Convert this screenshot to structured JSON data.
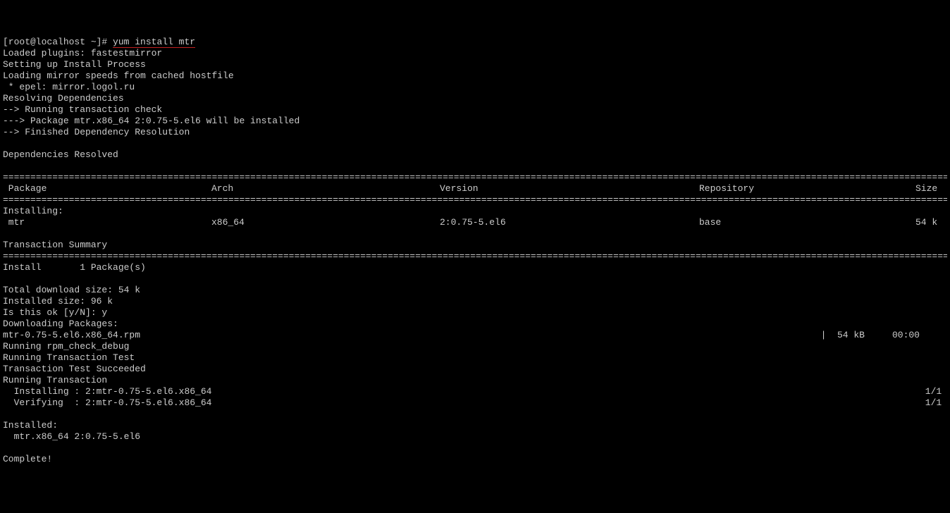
{
  "prompt_prefix": "[root@localhost ~]# ",
  "command": "yum install mtr",
  "lines_pre": [
    "Loaded plugins: fastestmirror",
    "Setting up Install Process",
    "Loading mirror speeds from cached hostfile",
    " * epel: mirror.logol.ru",
    "Resolving Dependencies",
    "--> Running transaction check",
    "---> Package mtr.x86_64 2:0.75-5.el6 will be installed",
    "--> Finished Dependency Resolution",
    "",
    "Dependencies Resolved",
    ""
  ],
  "headers": {
    "package": " Package",
    "arch": "Arch",
    "version": "Version",
    "repo": "Repository",
    "size": "Size "
  },
  "install_header": "Installing:",
  "pkg_row": {
    "package": " mtr",
    "arch": "x86_64",
    "version": "2:0.75-5.el6",
    "repo": "base",
    "size": "54 k "
  },
  "tx_summary": "Transaction Summary",
  "install_count": "Install       1 Package(s)",
  "post_lines_1": [
    "",
    "Total download size: 54 k",
    "Installed size: 96 k",
    "Is this ok [y/N]: y",
    "Downloading Packages:"
  ],
  "download_line_left": "mtr-0.75-5.el6.x86_64.rpm",
  "download_line_right": "|  54 kB     00:00     ",
  "post_lines_2": [
    "Running rpm_check_debug",
    "Running Transaction Test",
    "Transaction Test Succeeded",
    "Running Transaction"
  ],
  "installing_line_left": "  Installing : 2:mtr-0.75-5.el6.x86_64",
  "installing_line_right": "1/1 ",
  "verifying_line_left": "  Verifying  : 2:mtr-0.75-5.el6.x86_64",
  "verifying_line_right": "1/1 ",
  "post_lines_3": [
    "",
    "Installed:",
    "  mtr.x86_64 2:0.75-5.el6",
    "",
    "Complete!"
  ]
}
